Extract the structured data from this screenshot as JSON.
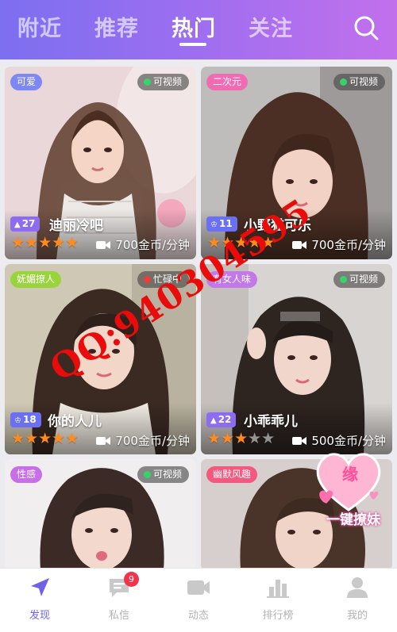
{
  "header": {
    "tabs": [
      {
        "label": "附近",
        "active": false
      },
      {
        "label": "推荐",
        "active": false
      },
      {
        "label": "热门",
        "active": true
      },
      {
        "label": "关注",
        "active": false
      }
    ],
    "search_icon": "search-icon"
  },
  "cards": [
    {
      "tag": "可爱",
      "tag_color": "#7e88f2",
      "status": "可视频",
      "status_dot": "#35d46a",
      "level_icon": "triangle-icon",
      "level": "27",
      "level_color": "#8d6cf2",
      "name": "迪丽冷吧",
      "stars": 5,
      "price": "700金币/分钟"
    },
    {
      "tag": "二次元",
      "tag_color": "#f06bb4",
      "status": "可视频",
      "status_dot": "#35d46a",
      "level_icon": "trophy-icon",
      "level": "11",
      "level_color": "#6b6ff2",
      "name": "小野猫可乐",
      "stars": 5,
      "price": "700金币/分钟"
    },
    {
      "tag": "妩媚撩人",
      "tag_color": "#9ad43d",
      "status": "忙碌中",
      "status_dot": "#f03b3b",
      "level_icon": "trophy-icon",
      "level": "18",
      "level_color": "#6b6ff2",
      "name": "你的人儿",
      "stars": 5,
      "price": "700金币/分钟"
    },
    {
      "tag": "有女人味",
      "tag_color": "#c278e8",
      "status": "可视频",
      "status_dot": "#35d46a",
      "level_icon": "triangle-icon",
      "level": "22",
      "level_color": "#8d6cf2",
      "name": "小乖乖儿",
      "stars": 3,
      "price": "500金币/分钟"
    },
    {
      "tag": "性感",
      "tag_color": "#c86ee8",
      "status": "可视频",
      "status_dot": "#35d46a"
    },
    {
      "tag": "幽默风趣",
      "tag_color": "#f5577f"
    }
  ],
  "watermark": {
    "text": "QQ:940304595",
    "color": "#ea0b0b"
  },
  "sticker": {
    "char": "缘",
    "text": "一键撩妹"
  },
  "bottom_nav": [
    {
      "label": "发现",
      "icon": "navigation-arrow-icon",
      "active": true
    },
    {
      "label": "私信",
      "icon": "chat-bubble-icon",
      "badge": "9"
    },
    {
      "label": "动态",
      "icon": "video-camera-icon"
    },
    {
      "label": "排行榜",
      "icon": "bar-chart-icon"
    },
    {
      "label": "我的",
      "icon": "user-icon"
    }
  ],
  "colors": {
    "accent": "#6e63e4",
    "star": "#ff8a1d"
  }
}
